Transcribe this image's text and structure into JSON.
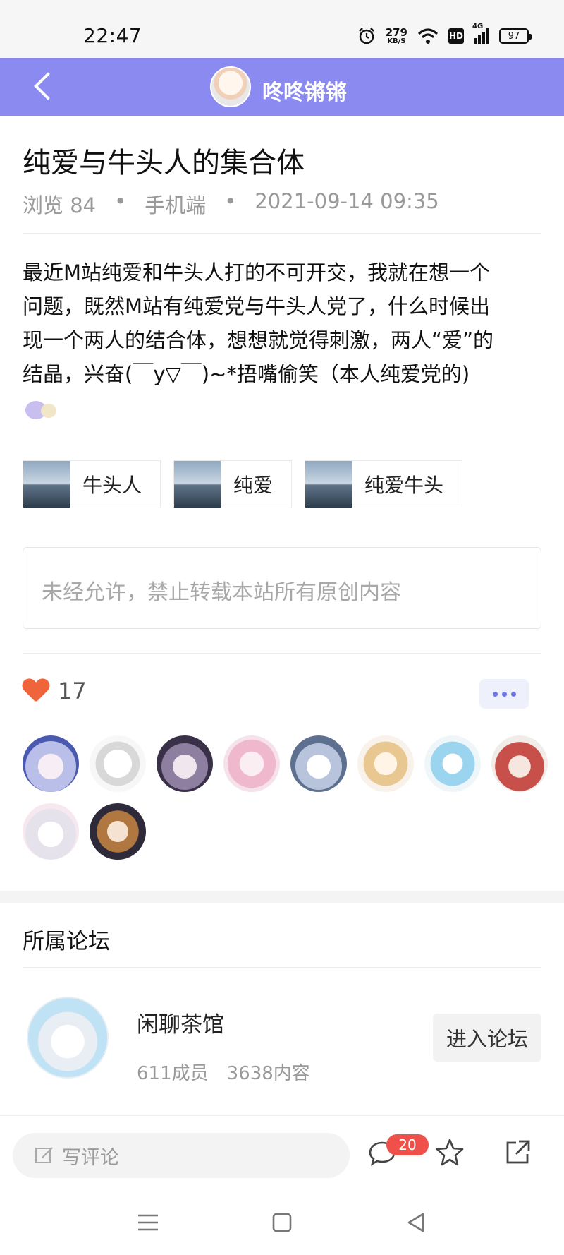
{
  "status_bar": {
    "time": "22:47",
    "net_speed_value": "279",
    "net_speed_unit": "KB/S",
    "hd_label": "HD",
    "network_label": "4G",
    "battery": "97"
  },
  "header": {
    "title": "咚咚锵锵"
  },
  "post": {
    "title": "纯爱与牛头人的集合体",
    "views": "浏览 84",
    "source": "手机端",
    "datetime": "2021-09-14 09:35",
    "content_lines": [
      "最近M站纯爱和牛头人打的不可开交，我就在想一个",
      "问题，既然M站有纯爱党与牛头人党了，什么时候出",
      "现一个两人的结合体，想想就觉得刺激，两人“爱”的",
      "结晶，兴奋(￣y▽￣)~*捂嘴偷笑（本人纯爱党的)"
    ],
    "tags": [
      "牛头人",
      "纯爱",
      "纯爱牛头"
    ],
    "notice": "未经允许，禁止转载本站所有原创内容"
  },
  "likes": {
    "count": "17"
  },
  "forum": {
    "section_title": "所属论坛",
    "name": "闲聊茶馆",
    "members": "611成员",
    "contents": "3638内容",
    "enter_label": "进入论坛"
  },
  "bottom_bar": {
    "comment_placeholder": "写评论",
    "comment_badge": "20"
  },
  "colors": {
    "header_bg": "#8a8af0",
    "heart": "#f0643c",
    "badge": "#f0504a",
    "more_dots": "#6f77e8"
  }
}
